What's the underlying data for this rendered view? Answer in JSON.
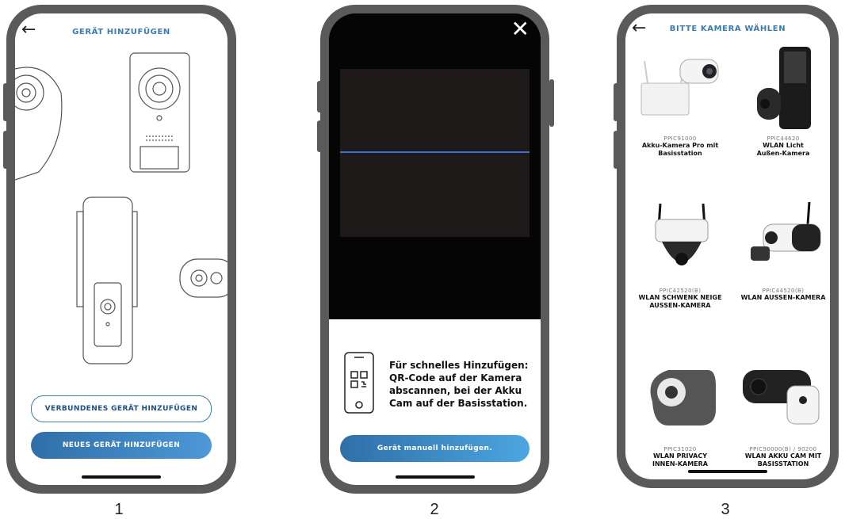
{
  "steps": [
    "1",
    "2",
    "3"
  ],
  "screen1": {
    "title": "GERÄT HINZUFÜGEN",
    "connected_button": "VERBUNDENES GERÄT HINZUFÜGEN",
    "new_button": "NEUES GERÄT HINZUFÜGEN"
  },
  "screen2": {
    "hint_lines": [
      "Für schnelles Hinzufügen:",
      "QR-Code auf der Kamera",
      "abscannen, bei der Akku",
      "Cam auf der Basisstation."
    ],
    "manual_button": "Gerät manuell hinzufügen.",
    "scanline_color": "#3b6fd6"
  },
  "screen3": {
    "title": "BITTE KAMERA WÄHLEN",
    "cameras": [
      {
        "code": "PPIC91000",
        "name_lines": [
          "Akku-Kamera Pro mit",
          "Basisstation"
        ]
      },
      {
        "code": "PPIC44620",
        "name_lines": [
          "WLAN Licht",
          "Außen-Kamera"
        ]
      },
      {
        "code": "PPIC42520(B)",
        "name_lines": [
          "WLAN SCHWENK NEIGE",
          "AUSSEN-KAMERA"
        ]
      },
      {
        "code": "PPIC44520(B)",
        "name_lines": [
          "WLAN AUSSEN-KAMERA"
        ]
      },
      {
        "code": "PPIC31020",
        "name_lines": [
          "WLAN PRIVACY",
          "INNEN-KAMERA"
        ]
      },
      {
        "code": "PPIC90000(B) / 90200",
        "name_lines": [
          "WLAN AKKU CAM MIT",
          "BASISSTATION"
        ]
      }
    ]
  },
  "accent_color": "#3c7bb0"
}
